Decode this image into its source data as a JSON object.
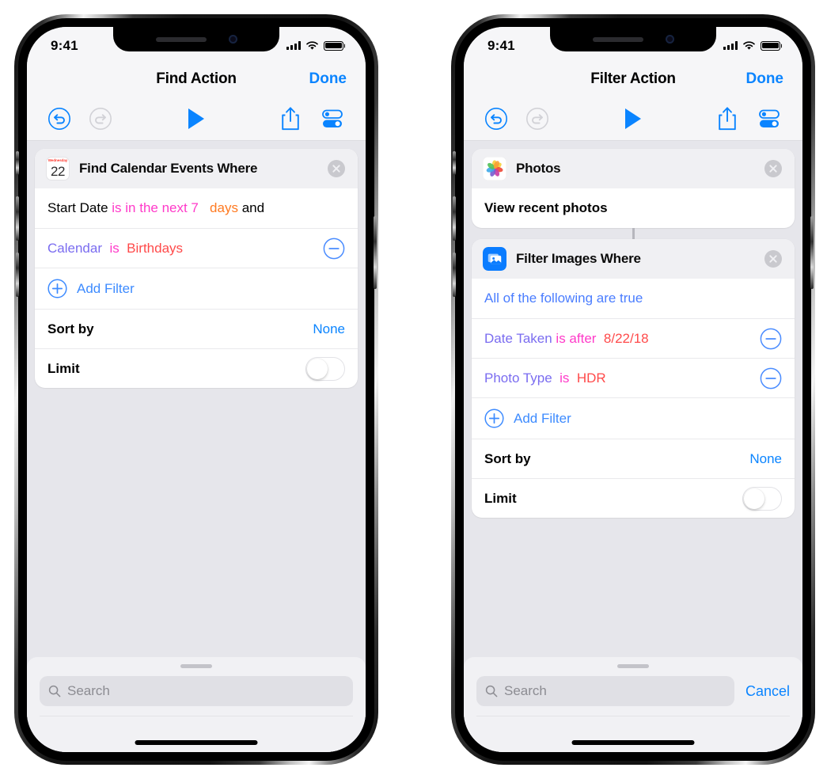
{
  "phones": [
    {
      "id": "find-action",
      "status": {
        "time": "9:41",
        "signal_icon": "cellular-bars-icon",
        "wifi_icon": "wifi-icon",
        "battery_icon": "battery-icon"
      },
      "nav": {
        "title": "Find Action",
        "done_label": "Done"
      },
      "toolbar": {
        "undo_icon": "undo-icon",
        "redo_icon": "redo-icon",
        "play_icon": "play-icon",
        "share_icon": "share-icon",
        "settings_icon": "toggles-icon"
      },
      "cards": [
        {
          "icon": "calendar-app-icon",
          "calendar_dow": "Wednesday",
          "calendar_day": "22",
          "title": "Find Calendar Events Where",
          "close_icon": "close-circle-icon",
          "filters": [
            {
              "tokens": [
                {
                  "text": "Start Date ",
                  "color": "black"
                },
                {
                  "text": "is in the next 7",
                  "color": "pink"
                },
                {
                  "text": "   days ",
                  "color": "orange"
                },
                {
                  "text": "and",
                  "color": "black"
                }
              ],
              "remove_icon": null
            },
            {
              "tokens": [
                {
                  "text": "Calendar",
                  "color": "purple"
                },
                {
                  "text": "  is  ",
                  "color": "pink"
                },
                {
                  "text": "Birthdays",
                  "color": "red"
                }
              ],
              "remove_icon": "minus-circle-icon"
            }
          ],
          "add_filter": {
            "icon": "plus-circle-icon",
            "label": "Add Filter"
          },
          "sort_by": {
            "label": "Sort by",
            "value": "None"
          },
          "limit": {
            "label": "Limit",
            "toggle_on": false
          }
        }
      ],
      "bottom": {
        "search_placeholder": "Search",
        "search_icon": "search-icon",
        "cancel_label": null
      }
    },
    {
      "id": "filter-action",
      "status": {
        "time": "9:41",
        "signal_icon": "cellular-bars-icon",
        "wifi_icon": "wifi-icon",
        "battery_icon": "battery-icon"
      },
      "nav": {
        "title": "Filter Action",
        "done_label": "Done"
      },
      "toolbar": {
        "undo_icon": "undo-icon",
        "redo_icon": "redo-icon",
        "play_icon": "play-icon",
        "share_icon": "share-icon",
        "settings_icon": "toggles-icon"
      },
      "photos_card": {
        "icon": "photos-app-icon",
        "title": "Photos",
        "close_icon": "close-circle-icon",
        "body_text": "View recent photos"
      },
      "cards": [
        {
          "icon": "filter-images-icon",
          "title": "Filter Images Where",
          "close_icon": "close-circle-icon",
          "condition_text": "All of the following are true",
          "filters": [
            {
              "tokens": [
                {
                  "text": "Date Taken ",
                  "color": "purple"
                },
                {
                  "text": "is after",
                  "color": "pink"
                },
                {
                  "text": "  8/22/18",
                  "color": "red"
                }
              ],
              "remove_icon": "minus-circle-icon"
            },
            {
              "tokens": [
                {
                  "text": "Photo Type",
                  "color": "purple"
                },
                {
                  "text": "  is  ",
                  "color": "pink"
                },
                {
                  "text": "HDR",
                  "color": "red"
                }
              ],
              "remove_icon": "minus-circle-icon"
            }
          ],
          "add_filter": {
            "icon": "plus-circle-icon",
            "label": "Add Filter"
          },
          "sort_by": {
            "label": "Sort by",
            "value": "None"
          },
          "limit": {
            "label": "Limit",
            "toggle_on": false
          }
        }
      ],
      "bottom": {
        "search_placeholder": "Search",
        "search_icon": "search-icon",
        "cancel_label": "Cancel"
      }
    }
  ],
  "colors": {
    "accent_blue": "#0a84ff",
    "token_pink": "#ff3ac9",
    "token_orange": "#ff7a21",
    "token_purple": "#7a6cf0",
    "token_red": "#ff4a4a",
    "token_blue": "#4a7dff",
    "card_bg": "#ffffff",
    "content_bg": "#e6e6eb",
    "chrome_bg": "#f6f6f8"
  }
}
